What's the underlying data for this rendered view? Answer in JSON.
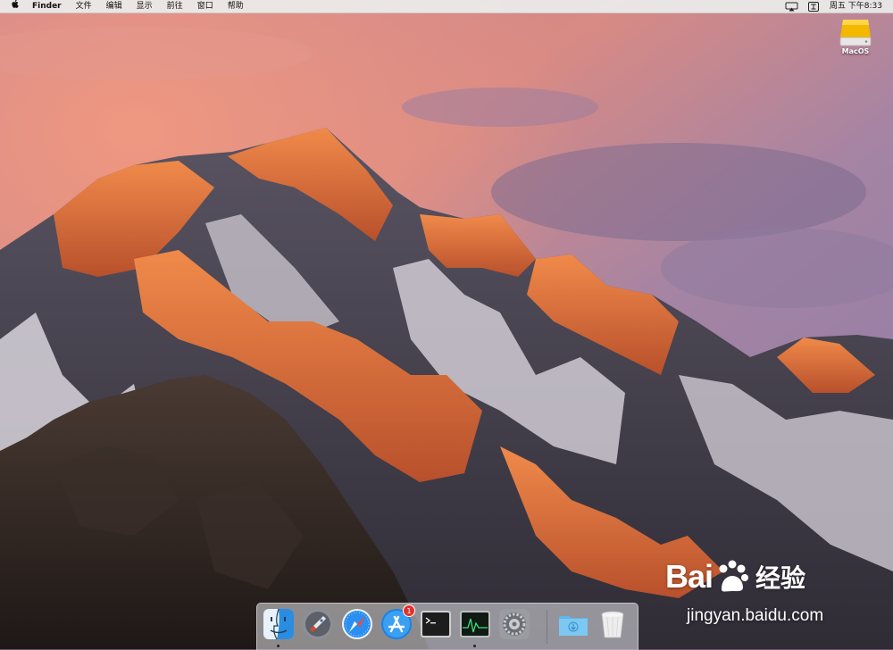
{
  "menubar": {
    "items": [
      "Finder",
      "文件",
      "编辑",
      "显示",
      "前往",
      "窗口",
      "帮助"
    ],
    "clock": "周五 下午8:33",
    "status_icons": [
      "airplay-icon",
      "input-method-icon"
    ]
  },
  "desktop": {
    "icons": [
      {
        "label": "MacOS",
        "icon": "hard-drive-icon"
      }
    ]
  },
  "dock": {
    "apps": [
      {
        "name": "finder",
        "running": true
      },
      {
        "name": "launchpad",
        "running": false
      },
      {
        "name": "safari",
        "running": false
      },
      {
        "name": "app-store",
        "running": false,
        "badge": "1"
      },
      {
        "name": "terminal",
        "running": false
      },
      {
        "name": "activity-monitor",
        "running": true
      },
      {
        "name": "system-preferences",
        "running": false
      },
      {
        "name": "downloads-folder",
        "running": false
      },
      {
        "name": "trash",
        "running": false
      }
    ]
  },
  "watermark": {
    "brand": "Bai",
    "brand_cn": "经验",
    "url": "jingyan.baidu.com"
  },
  "colors": {
    "sky_top": "#c9868f",
    "sky_right": "#8a79a8",
    "mountain_lit": "#e0713d",
    "mountain_shadow": "#3f3a47",
    "snow": "#d9d4dc",
    "rock_foreground": "#2e2522"
  }
}
